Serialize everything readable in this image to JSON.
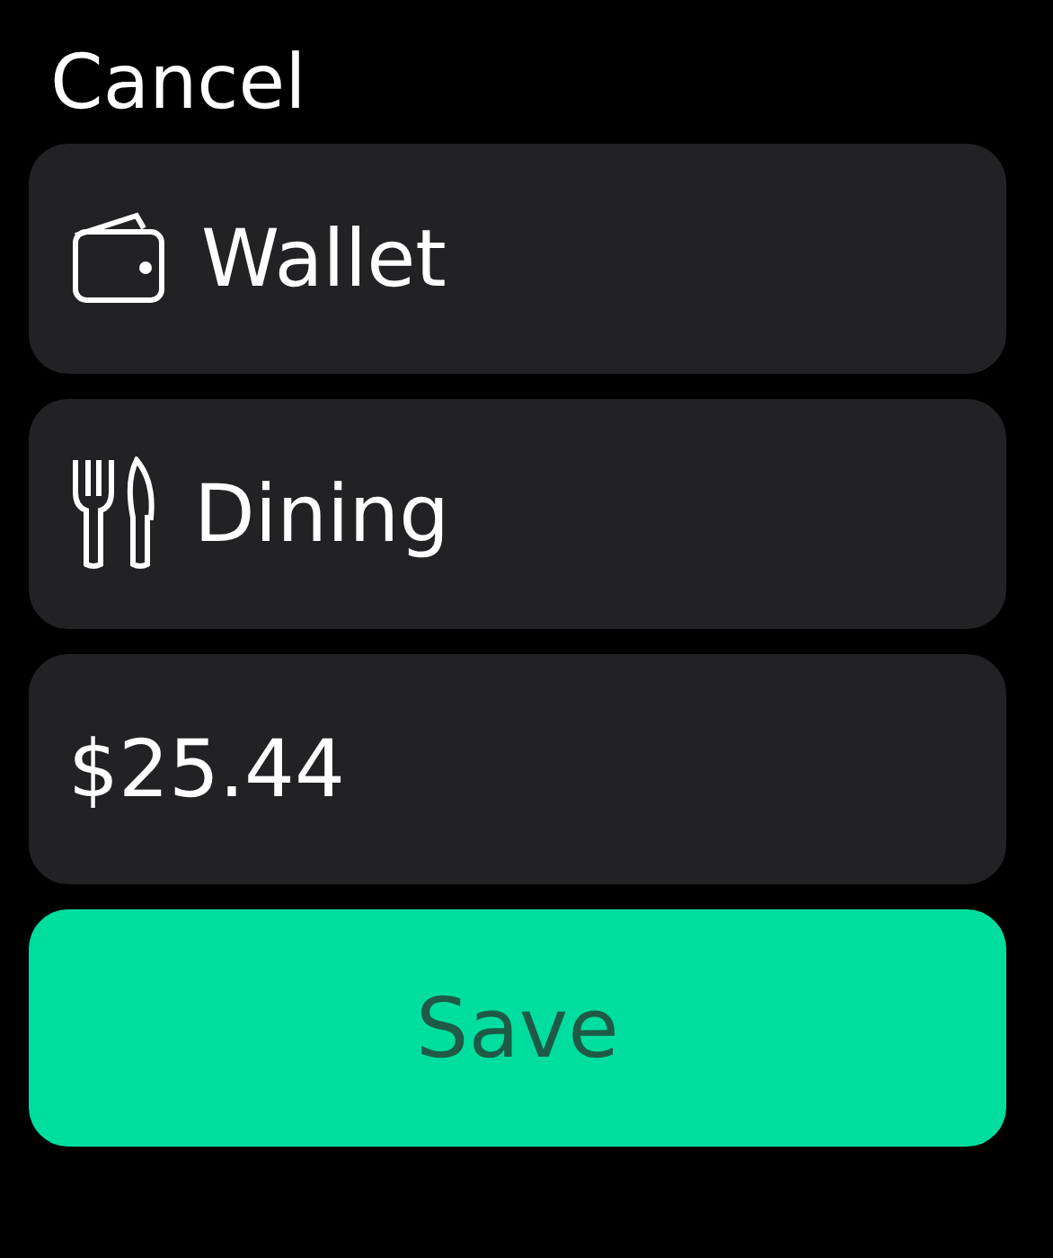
{
  "cancel": "Cancel",
  "rows": [
    {
      "kind": "wallet",
      "label": "Wallet"
    },
    {
      "kind": "dining",
      "label": "Dining"
    },
    {
      "kind": "amount",
      "label": "$25.44"
    }
  ],
  "save": "Save"
}
